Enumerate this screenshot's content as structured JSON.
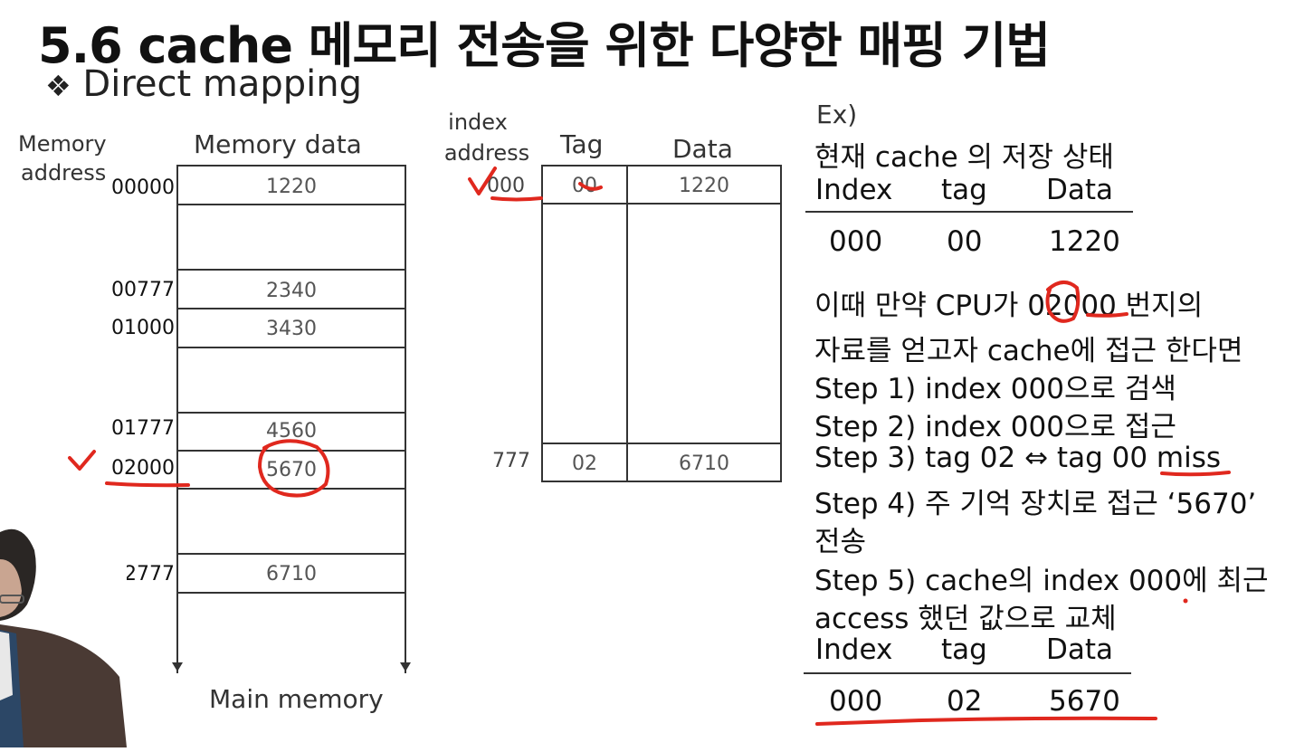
{
  "title": "5.6 cache 메모리 전송을 위한 다양한 매핑 기법",
  "subtitle_bullet": "❖",
  "subtitle": "Direct mapping",
  "memory": {
    "address_header": [
      "Memory",
      "address"
    ],
    "data_header": "Memory data",
    "footer": "Main memory",
    "rows": [
      {
        "address": "00000",
        "value": "1220"
      },
      {
        "address": "00777",
        "value": "2340"
      },
      {
        "address": "01000",
        "value": "3430"
      },
      {
        "address": "01777",
        "value": "4560"
      },
      {
        "address": "02000",
        "value": "5670"
      },
      {
        "address": "02777",
        "value": "6710"
      }
    ]
  },
  "cache": {
    "index_header": [
      "index",
      "address"
    ],
    "tag_header": "Tag",
    "data_header": "Data",
    "rows": [
      {
        "index": "000",
        "tag": "00",
        "data": "1220"
      },
      {
        "index": "777",
        "tag": "02",
        "data": "6710"
      }
    ]
  },
  "example": {
    "label": "Ex)",
    "state_heading": "현재 cache 의 저장 상태",
    "table_headers": [
      "Index",
      "tag",
      "Data"
    ],
    "before_row": [
      "000",
      "00",
      "1220"
    ],
    "lines": [
      "이때 만약 CPU가 02000 번지의",
      "자료를 얻고자 cache에 접근 한다면",
      "Step 1) index 000으로 검색",
      "Step 2) index 000으로 접근",
      "Step 3) tag 02 ⇔ tag 00 miss",
      "Step 4) 주 기억 장치로 접근 ‘5670’",
      "전송",
      "Step 5) cache의 index 000에 최근",
      "access 했던 값으로 교체"
    ],
    "after_row": [
      "000",
      "02",
      "5670"
    ]
  },
  "colors": {
    "annotation": "#e0281e",
    "ink": "#111111",
    "cell_text": "#555555"
  }
}
